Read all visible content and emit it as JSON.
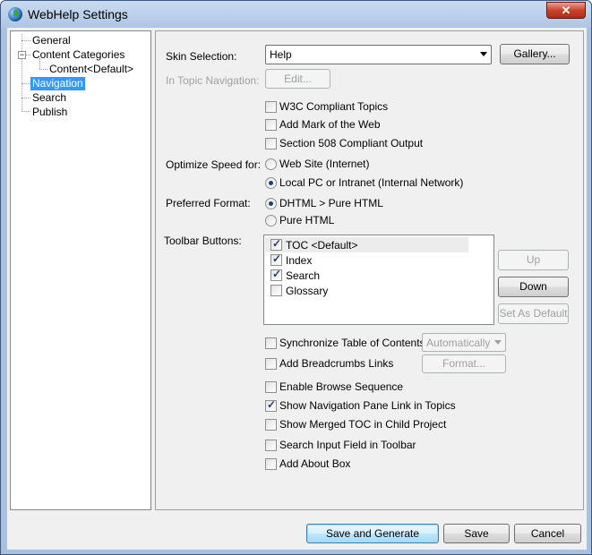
{
  "window": {
    "title": "WebHelp Settings",
    "close_glyph": "✕"
  },
  "tree": {
    "items": [
      {
        "label": "General"
      },
      {
        "label": "Content Categories",
        "expander": "−"
      },
      {
        "label": "Content<Default>"
      },
      {
        "label": "Navigation",
        "selected": true
      },
      {
        "label": "Search"
      },
      {
        "label": "Publish"
      }
    ]
  },
  "skin": {
    "label": "Skin Selection:",
    "value": "Help",
    "gallery_label": "Gallery..."
  },
  "topic_nav": {
    "label": "In Topic Navigation:",
    "edit_label": "Edit..."
  },
  "checks_top": [
    {
      "label": "W3C Compliant Topics",
      "checked": false
    },
    {
      "label": "Add Mark of the Web",
      "checked": false
    },
    {
      "label": "Section 508 Compliant Output",
      "checked": false
    }
  ],
  "optimize": {
    "label": "Optimize Speed for:",
    "options": [
      {
        "label": "Web Site (Internet)",
        "selected": false
      },
      {
        "label": "Local PC or Intranet (Internal Network)",
        "selected": true
      }
    ]
  },
  "format": {
    "label": "Preferred Format:",
    "options": [
      {
        "label": "DHTML > Pure HTML",
        "selected": true
      },
      {
        "label": "Pure HTML",
        "selected": false
      }
    ]
  },
  "toolbar": {
    "label": "Toolbar Buttons:",
    "items": [
      {
        "label": "TOC <Default>",
        "checked": true
      },
      {
        "label": "Index",
        "checked": true
      },
      {
        "label": "Search",
        "checked": true
      },
      {
        "label": "Glossary",
        "checked": false
      }
    ],
    "up_label": "Up",
    "down_label": "Down",
    "default_label": "Set As Default"
  },
  "sync": {
    "label": "Synchronize Table of Contents",
    "checked": false,
    "mode": "Automatically"
  },
  "breadcrumbs": {
    "label": "Add Breadcrumbs Links",
    "checked": false,
    "format_label": "Format..."
  },
  "checks_bottom": [
    {
      "label": "Enable Browse Sequence",
      "checked": false
    },
    {
      "label": "Show Navigation Pane Link in Topics",
      "checked": true
    },
    {
      "label": "Show Merged TOC in Child Project",
      "checked": false
    },
    {
      "label": "Search Input Field in Toolbar",
      "checked": false
    },
    {
      "label": "Add About Box",
      "checked": false
    }
  ],
  "footer": {
    "generate_label": "Save and Generate",
    "save_label": "Save",
    "cancel_label": "Cancel"
  }
}
